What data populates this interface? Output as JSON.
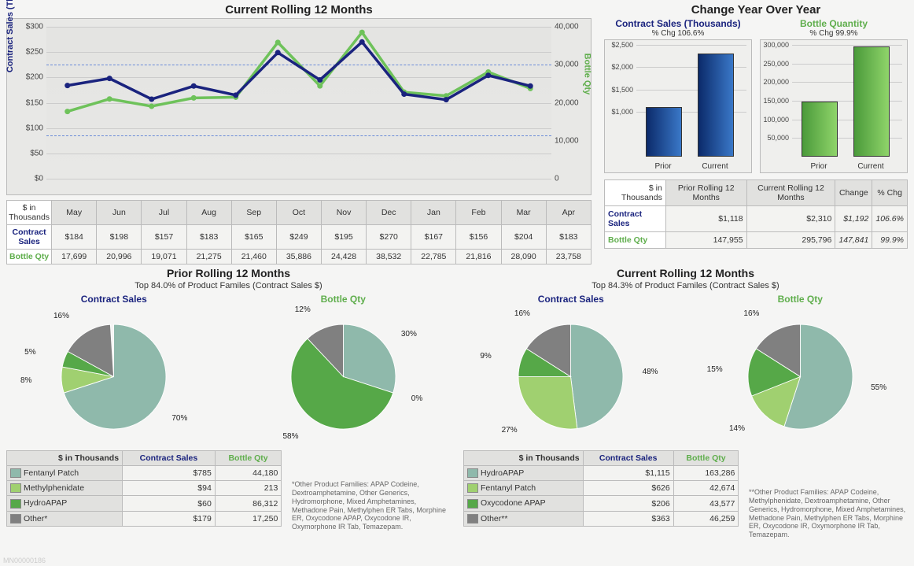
{
  "chart_data": [
    {
      "type": "line",
      "title": "Current Rolling 12 Months",
      "x_categories": [
        "May",
        "Jun",
        "Jul",
        "Aug",
        "Sep",
        "Oct",
        "Nov",
        "Dec",
        "Jan",
        "Feb",
        "Mar",
        "Apr"
      ],
      "left_axis": {
        "label": "Contract Sales (Thousands)",
        "ticks": [
          0,
          50,
          100,
          150,
          200,
          250,
          300
        ],
        "ylim": [
          0,
          300
        ]
      },
      "right_axis": {
        "label": "Bottle Qty",
        "ticks": [
          0,
          10000,
          20000,
          30000,
          40000
        ],
        "ylim": [
          0,
          40000
        ]
      },
      "series": [
        {
          "name": "Contract Sales",
          "axis": "left",
          "color": "#1a237e",
          "values": [
            184,
            198,
            157,
            183,
            165,
            249,
            195,
            270,
            167,
            156,
            204,
            183
          ]
        },
        {
          "name": "Bottle Qty",
          "axis": "right",
          "color": "#6ec25a",
          "values": [
            17699,
            20996,
            19071,
            21275,
            21460,
            35886,
            24428,
            38532,
            22785,
            21816,
            28090,
            23758
          ]
        }
      ]
    },
    {
      "type": "bar",
      "title": "Contract Sales (Thousands)",
      "subtitle": "% Chg 106.6%",
      "categories": [
        "Prior",
        "Current"
      ],
      "values": [
        1118,
        2310
      ],
      "ylim": [
        0,
        2500
      ],
      "yticks": [
        1000,
        1500,
        2000,
        2500
      ],
      "color": "blue"
    },
    {
      "type": "bar",
      "title": "Bottle Quantity",
      "subtitle": "% Chg 99.9%",
      "categories": [
        "Prior",
        "Current"
      ],
      "values": [
        147955,
        295796
      ],
      "ylim": [
        0,
        300000
      ],
      "yticks": [
        50000,
        100000,
        150000,
        200000,
        250000,
        300000
      ],
      "color": "green"
    },
    {
      "type": "pie",
      "group": "Prior Rolling 12 Months",
      "title": "Contract Sales",
      "slices": [
        {
          "name": "Fentanyl Patch",
          "pct": 70,
          "color": "#8fb9ab"
        },
        {
          "name": "Methylphenidate",
          "pct": 8,
          "color": "#a0d070"
        },
        {
          "name": "HydroAPAP",
          "pct": 5,
          "color": "#56a848"
        },
        {
          "name": "Other*",
          "pct": 16,
          "color": "#808080"
        }
      ]
    },
    {
      "type": "pie",
      "group": "Prior Rolling 12 Months",
      "title": "Bottle Qty",
      "slices": [
        {
          "name": "Fentanyl Patch",
          "pct": 30,
          "color": "#8fb9ab"
        },
        {
          "name": "Methylphenidate",
          "pct": 0,
          "color": "#a0d070"
        },
        {
          "name": "HydroAPAP",
          "pct": 58,
          "color": "#56a848"
        },
        {
          "name": "Other*",
          "pct": 12,
          "color": "#808080"
        }
      ]
    },
    {
      "type": "pie",
      "group": "Current Rolling 12 Months",
      "title": "Contract Sales",
      "slices": [
        {
          "name": "HydroAPAP",
          "pct": 48,
          "color": "#8fb9ab"
        },
        {
          "name": "Fentanyl Patch",
          "pct": 27,
          "color": "#a0d070"
        },
        {
          "name": "Oxycodone APAP",
          "pct": 9,
          "color": "#56a848"
        },
        {
          "name": "Other**",
          "pct": 16,
          "color": "#808080"
        }
      ]
    },
    {
      "type": "pie",
      "group": "Current Rolling 12 Months",
      "title": "Bottle Qty",
      "slices": [
        {
          "name": "HydroAPAP",
          "pct": 55,
          "color": "#8fb9ab"
        },
        {
          "name": "Fentanyl Patch",
          "pct": 14,
          "color": "#a0d070"
        },
        {
          "name": "Oxycodone APAP",
          "pct": 15,
          "color": "#56a848"
        },
        {
          "name": "Other**",
          "pct": 16,
          "color": "#808080"
        }
      ]
    }
  ],
  "main": {
    "title": "Current Rolling 12 Months",
    "corner": "$ in Thousands",
    "row1_label": "Contract Sales",
    "row2_label": "Bottle Qty",
    "months": [
      "May",
      "Jun",
      "Jul",
      "Aug",
      "Sep",
      "Oct",
      "Nov",
      "Dec",
      "Jan",
      "Feb",
      "Mar",
      "Apr"
    ],
    "row1": [
      "$184",
      "$198",
      "$157",
      "$183",
      "$165",
      "$249",
      "$195",
      "$270",
      "$167",
      "$156",
      "$204",
      "$183"
    ],
    "row2": [
      "17,699",
      "20,996",
      "19,071",
      "21,275",
      "21,460",
      "35,886",
      "24,428",
      "38,532",
      "22,785",
      "21,816",
      "28,090",
      "23,758"
    ],
    "left_axis": "Contract Sales (Thousands)",
    "right_axis": "Bottle Qty",
    "left_ticks": [
      "$0",
      "$50",
      "$100",
      "$150",
      "$200",
      "$250",
      "$300"
    ],
    "right_ticks": [
      "0",
      "10,000",
      "20,000",
      "30,000",
      "40,000"
    ]
  },
  "yoy": {
    "title": "Change Year Over Year",
    "cs": {
      "title": "Contract Sales (Thousands)",
      "sub": "% Chg 106.6%",
      "ticks": [
        "$1,000",
        "$1,500",
        "$2,000",
        "$2,500"
      ],
      "cats": [
        "Prior",
        "Current"
      ]
    },
    "bq": {
      "title": "Bottle Quantity",
      "sub": "% Chg 99.9%",
      "ticks": [
        "50,000",
        "100,000",
        "150,000",
        "200,000",
        "250,000",
        "300,000"
      ],
      "cats": [
        "Prior",
        "Current"
      ]
    },
    "table": {
      "corner": "$ in Thousands",
      "headers": [
        "Prior Rolling 12 Months",
        "Current Rolling 12 Months",
        "Change",
        "% Chg"
      ],
      "rows": [
        {
          "label": "Contract Sales",
          "cls": "cs",
          "cells": [
            "$1,118",
            "$2,310",
            "$1,192",
            "106.6%"
          ]
        },
        {
          "label": "Bottle Qty",
          "cls": "bq",
          "cells": [
            "147,955",
            "295,796",
            "147,841",
            "99.9%"
          ]
        }
      ]
    }
  },
  "prior": {
    "title": "Prior Rolling 12 Months",
    "subtitle": "Top 84.0% of Product Familes (Contract Sales $)",
    "cs_title": "Contract Sales",
    "bq_title": "Bottle Qty",
    "table": {
      "corner": "$ in Thousands",
      "headers": [
        "Contract Sales",
        "Bottle Qty"
      ],
      "rows": [
        {
          "sw": "c-teal",
          "name": "Fentanyl Patch",
          "cs": "$785",
          "bq": "44,180"
        },
        {
          "sw": "c-lgreen",
          "name": "Methylphenidate",
          "cs": "$94",
          "bq": "213"
        },
        {
          "sw": "c-green",
          "name": "HydroAPAP",
          "cs": "$60",
          "bq": "86,312"
        },
        {
          "sw": "c-gray",
          "name": "Other*",
          "cs": "$179",
          "bq": "17,250"
        }
      ]
    },
    "footnote": "*Other Product Families:\nAPAP Codeine, Dextroamphetamine, Other Generics, Hydromorphone, Mixed Amphetamines, Methadone Pain, Methylphen ER Tabs, Morphine ER, Oxycodone APAP, Oxycodone IR, Oxymorphone IR Tab, Temazepam."
  },
  "current": {
    "title": "Current Rolling 12 Months",
    "subtitle": "Top 84.3% of Product Familes (Contract Sales $)",
    "cs_title": "Contract Sales",
    "bq_title": "Bottle Qty",
    "table": {
      "corner": "$ in Thousands",
      "headers": [
        "Contract Sales",
        "Bottle Qty"
      ],
      "rows": [
        {
          "sw": "c-teal",
          "name": "HydroAPAP",
          "cs": "$1,115",
          "bq": "163,286"
        },
        {
          "sw": "c-lgreen",
          "name": "Fentanyl Patch",
          "cs": "$626",
          "bq": "42,674"
        },
        {
          "sw": "c-green",
          "name": "Oxycodone APAP",
          "cs": "$206",
          "bq": "43,577"
        },
        {
          "sw": "c-gray",
          "name": "Other**",
          "cs": "$363",
          "bq": "46,259"
        }
      ]
    },
    "footnote": "**Other Product Families:\nAPAP Codeine, Methylphenidate, Dextroamphetamine, Other Generics, Hydromorphone, Mixed Amphetamines, Methadone Pain, Methylphen ER Tabs, Morphine ER, Oxycodone IR, Oxymorphone IR Tab, Temazepam."
  },
  "watermark": "MN00000186"
}
